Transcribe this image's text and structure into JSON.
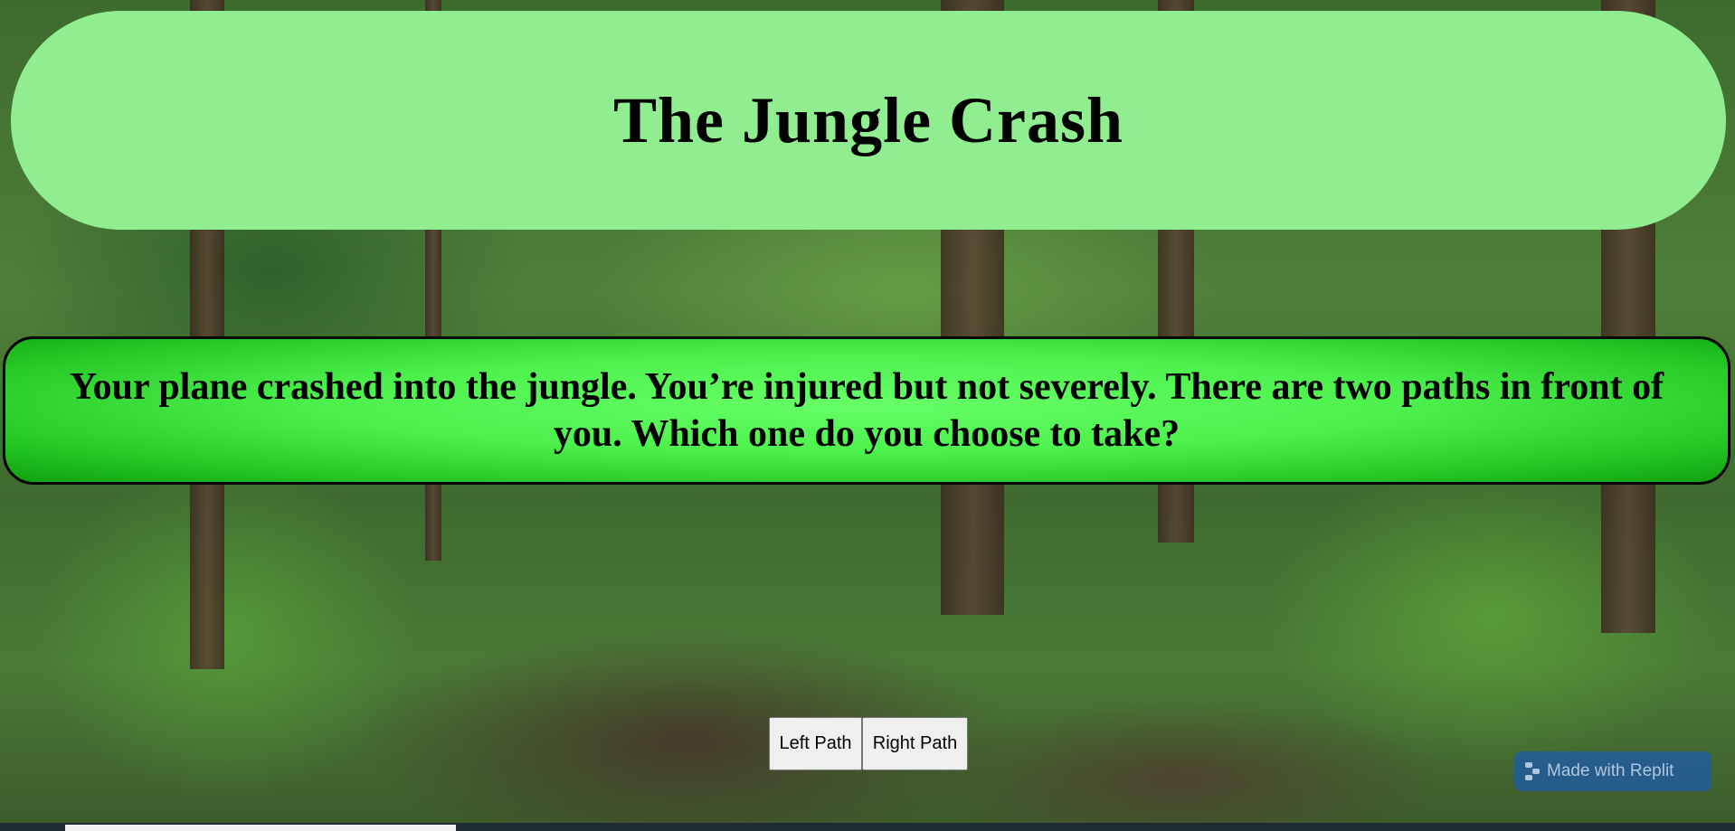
{
  "title": "The Jungle Crash",
  "story": {
    "text": "Your plane crashed into the jungle. You’re injured but not severely. There are two paths in front of you. Which one do you choose to take?"
  },
  "choices": {
    "left_label": "Left Path",
    "right_label": "Right Path"
  },
  "badge": {
    "label": "Made with Replit",
    "icon": "replit-logo-icon"
  },
  "colors": {
    "title_panel": "#90ee90",
    "story_panel": "#4cf04c",
    "badge": "#1e5aaa"
  }
}
